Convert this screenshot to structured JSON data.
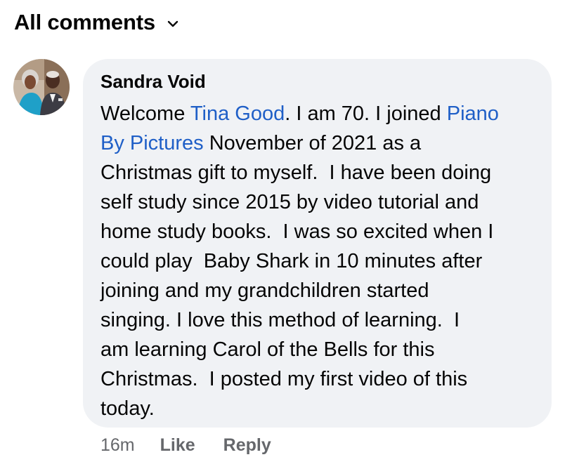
{
  "header": {
    "title": "All comments",
    "chevron_icon": "chevron-down-icon"
  },
  "comment": {
    "author": "Sandra Void",
    "avatar_icon": "profile-photo",
    "lines": [
      {
        "pre": "Welcome ",
        "link": "Tina Good",
        "post": ". I am 70. I joined ",
        "link2": "Piano"
      },
      {
        "link": "By Pictures",
        "post": " November of 2021 as a"
      },
      {
        "text": "Christmas gift to myself.  I have been doing"
      },
      {
        "text": "self study since 2015 by video tutorial and"
      },
      {
        "text": "home study books.  I was so excited when I"
      },
      {
        "text": "could play  Baby Shark in 10 minutes after"
      },
      {
        "text": "joining and my grandchildren started"
      },
      {
        "text": "singing. I love this method of learning.  I"
      },
      {
        "text": "am learning Carol of the Bells for this"
      },
      {
        "text": "Christmas.  I posted my first video of this"
      },
      {
        "text": "today."
      }
    ],
    "time": "16m",
    "like_label": "Like",
    "reply_label": "Reply"
  },
  "colors": {
    "bubble": "#f0f2f5",
    "link": "#1f5fc7",
    "meta": "#65676b"
  }
}
